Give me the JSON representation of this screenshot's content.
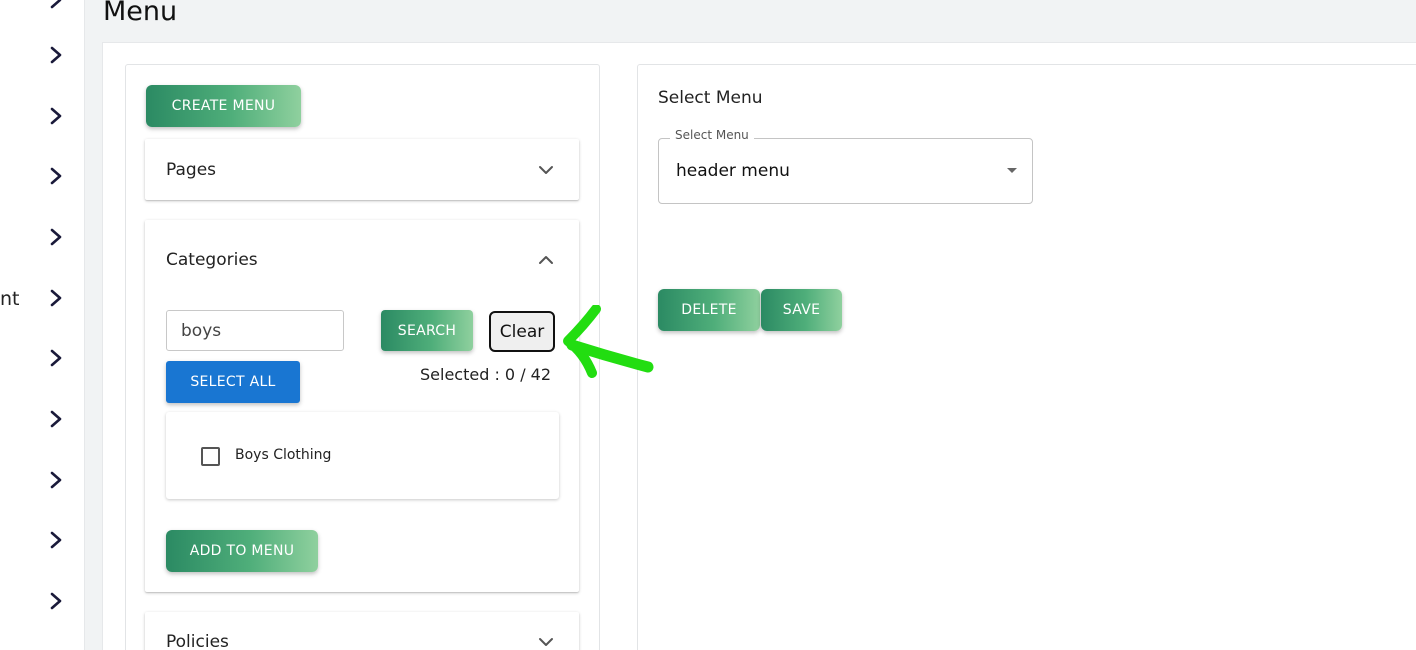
{
  "page": {
    "title": "Menu"
  },
  "sidebar": {
    "items": [
      {
        "label": ""
      },
      {
        "label": ""
      },
      {
        "label": ""
      },
      {
        "label": ""
      },
      {
        "label": ""
      },
      {
        "label": "nt"
      },
      {
        "label": ""
      },
      {
        "label": ""
      },
      {
        "label": ""
      },
      {
        "label": ""
      },
      {
        "label": ""
      }
    ]
  },
  "left_panel": {
    "create_menu_label": "CREATE MENU",
    "pages": {
      "title": "Pages"
    },
    "categories": {
      "title": "Categories",
      "search_value": "boys",
      "search_label": "SEARCH",
      "clear_label": "Clear",
      "select_all_label": "SELECT ALL",
      "selected_text": "Selected : 0 / 42",
      "items": [
        {
          "label": "Boys Clothing",
          "checked": false
        }
      ],
      "add_to_menu_label": "ADD TO MENU"
    },
    "policies": {
      "title": "Policies"
    }
  },
  "right_panel": {
    "heading": "Select Menu",
    "select": {
      "legend": "Select Menu",
      "value": "header menu"
    },
    "delete_label": "DELETE",
    "save_label": "SAVE"
  },
  "colors": {
    "accent_green_start": "#2b8a63",
    "accent_green_end": "#8fd09e",
    "accent_blue": "#1976d2",
    "annotation_green": "#22dd11"
  },
  "icons": {
    "sidebar_chevron": "chevron-right-icon",
    "accordion_collapsed": "chevron-down-icon",
    "accordion_expanded": "chevron-up-icon",
    "select_dropdown": "caret-down-icon",
    "annotation": "arrow-annotation-icon"
  }
}
